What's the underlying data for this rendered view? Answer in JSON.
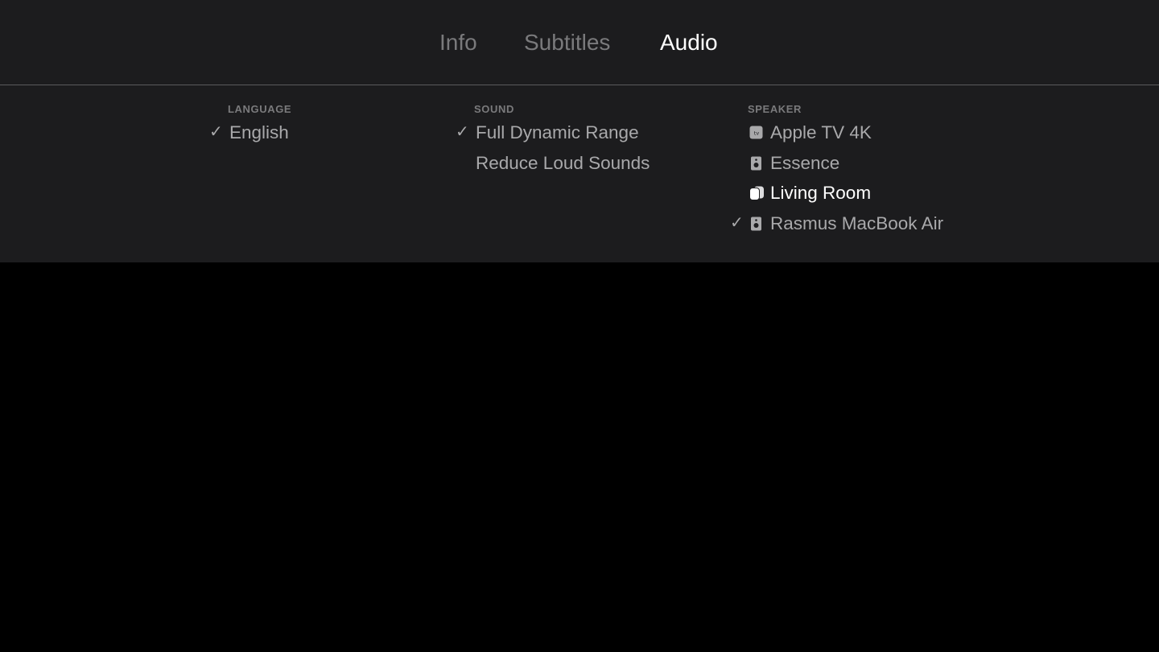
{
  "tabs": [
    {
      "label": "Info",
      "active": false
    },
    {
      "label": "Subtitles",
      "active": false
    },
    {
      "label": "Audio",
      "active": true
    }
  ],
  "language": {
    "header": "LANGUAGE",
    "items": [
      {
        "label": "English",
        "checked": true
      }
    ]
  },
  "sound": {
    "header": "SOUND",
    "items": [
      {
        "label": "Full Dynamic Range",
        "checked": true
      },
      {
        "label": "Reduce Loud Sounds",
        "checked": false
      }
    ]
  },
  "speaker": {
    "header": "SPEAKER",
    "items": [
      {
        "label": "Apple TV 4K",
        "icon": "apple-tv-icon",
        "checked": false,
        "highlighted": false
      },
      {
        "label": "Essence",
        "icon": "speaker-icon",
        "checked": false,
        "highlighted": false
      },
      {
        "label": "Living Room",
        "icon": "homepod-pair-icon",
        "checked": false,
        "highlighted": true
      },
      {
        "label": "Rasmus MacBook Air",
        "icon": "speaker-icon",
        "checked": true,
        "highlighted": false
      }
    ]
  },
  "check_glyph": "✓",
  "colors": {
    "panel_bg": "#1c1c1e",
    "screen_bg": "#000000",
    "text_inactive": "#a9a9ab",
    "text_active": "#ffffff",
    "header_text": "#7a7a7c"
  }
}
